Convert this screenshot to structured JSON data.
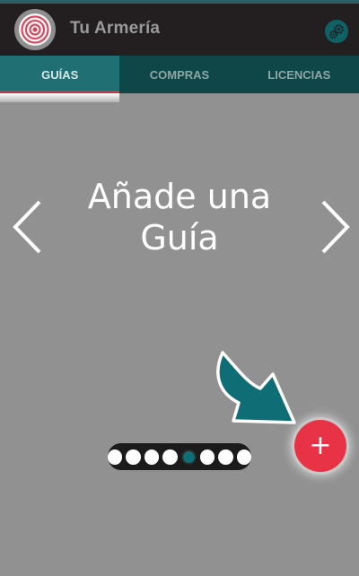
{
  "app_bar": {
    "title": "Tu Armería",
    "logo_icon": "target-logo-icon",
    "settings_icon": "gears-icon"
  },
  "tabs": [
    {
      "label": "GUÍAS",
      "active": true
    },
    {
      "label": "COMPRAS",
      "active": false
    },
    {
      "label": "LICENCIAS",
      "active": false
    }
  ],
  "tutorial": {
    "headline": "Añade una Guía",
    "prev_icon": "chevron-left-icon",
    "next_icon": "chevron-right-icon",
    "hint_icon": "curved-arrow-icon",
    "pages_total": 8,
    "page_current": 5
  },
  "fab": {
    "label": "+",
    "icon": "plus-icon"
  },
  "colors": {
    "app_bar_bg": "#231f20",
    "tab_bar_bg": "#0f4648",
    "tab_active_bg": "#206f73",
    "tab_indicator": "#c23a4a",
    "overlay_bg": "#919191",
    "fab_bg": "#e83245",
    "accent_teal": "#0f6f77"
  }
}
